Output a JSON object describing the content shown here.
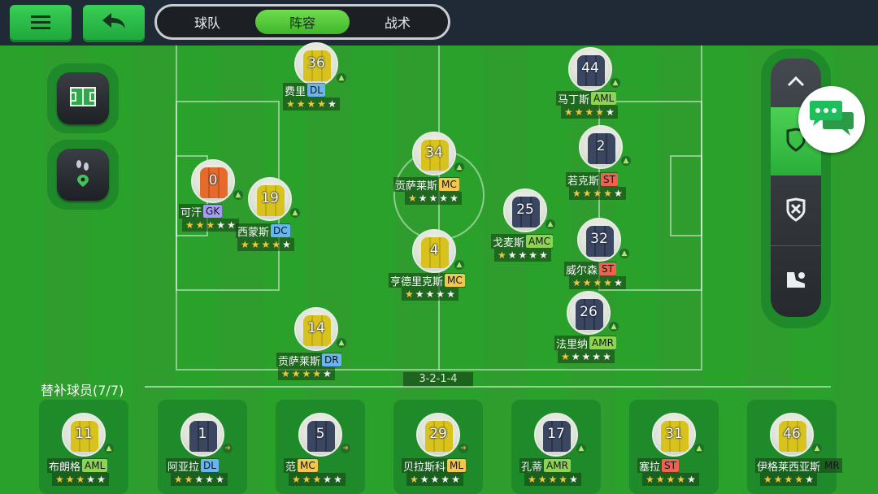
{
  "colors": {
    "accent": "#39cf55",
    "topbar": "#1f2a36"
  },
  "topbar": {
    "menu_icon": "hamburger-menu-icon",
    "back_icon": "back-arrow-icon",
    "tabs": [
      {
        "label": "球队"
      },
      {
        "label": "阵容",
        "active": true
      },
      {
        "label": "战术"
      }
    ]
  },
  "side_buttons": [
    {
      "icon": "tactics-board-icon"
    },
    {
      "icon": "footsteps-location-icon"
    }
  ],
  "right_panel": [
    {
      "icon": "chevron-up-icon"
    },
    {
      "icon": "shield-icon"
    },
    {
      "icon": "shield-x-icon"
    },
    {
      "icon": "boot-icon"
    }
  ],
  "chat_icon": "chat-bubbles-icon",
  "players": [
    {
      "number": "36",
      "name": "费里",
      "pos": "DL",
      "stars": 4,
      "kit": "yellow",
      "arrow": "up"
    },
    {
      "number": "44",
      "name": "马丁斯",
      "pos": "AML",
      "stars": 4,
      "kit": "navy",
      "arrow": "up"
    },
    {
      "number": "34",
      "name": "贡萨莱斯",
      "pos": "MC",
      "stars": 1.5,
      "kit": "yellow",
      "arrow": "up"
    },
    {
      "number": "2",
      "name": "若克斯",
      "pos": "ST",
      "stars": 4.5,
      "kit": "navy",
      "arrow": "up"
    },
    {
      "number": "0",
      "name": "可汗",
      "pos": "GK",
      "stars": 3.5,
      "kit": "orange",
      "arrow": "up"
    },
    {
      "number": "19",
      "name": "西蒙斯",
      "pos": "DC",
      "stars": 4,
      "kit": "yellow",
      "arrow": "up"
    },
    {
      "number": "25",
      "name": "戈麦斯",
      "pos": "AMC",
      "stars": 1,
      "kit": "navy",
      "arrow": "up"
    },
    {
      "number": "32",
      "name": "威尔森",
      "pos": "ST",
      "stars": 4,
      "kit": "navy",
      "arrow": "up"
    },
    {
      "number": "4",
      "name": "亨德里克斯",
      "pos": "MC",
      "stars": 1,
      "kit": "yellow",
      "arrow": "up"
    },
    {
      "number": "26",
      "name": "法里纳",
      "pos": "AMR",
      "stars": 1,
      "kit": "navy",
      "arrow": "up"
    },
    {
      "number": "14",
      "name": "贡萨莱斯",
      "pos": "DR",
      "stars": 4,
      "kit": "yellow",
      "arrow": "up"
    }
  ],
  "formation": "3-2-1-4",
  "bench": {
    "title": "替补球员(7/7)",
    "players": [
      {
        "number": "11",
        "name": "布朗格",
        "pos": "AML",
        "stars": 3,
        "kit": "yellow",
        "arrow": "up"
      },
      {
        "number": "1",
        "name": "阿亚拉",
        "pos": "DL",
        "stars": 2.5,
        "kit": "navy",
        "arrow": "right"
      },
      {
        "number": "5",
        "name": "范",
        "pos": "MC",
        "stars": 3,
        "kit": "navy",
        "arrow": "right"
      },
      {
        "number": "29",
        "name": "贝拉斯科",
        "pos": "ML",
        "stars": 1.5,
        "kit": "yellow",
        "arrow": "right"
      },
      {
        "number": "17",
        "name": "孔蒂",
        "pos": "AMR",
        "stars": 4,
        "kit": "navy",
        "arrow": "up"
      },
      {
        "number": "31",
        "name": "塞拉",
        "pos": "ST",
        "stars": 4,
        "kit": "yellow",
        "arrow": "up"
      },
      {
        "number": "46",
        "name": "伊格莱西亚斯",
        "pos": "MR",
        "stars": 4,
        "kit": "yellow",
        "arrow": "up"
      }
    ]
  }
}
